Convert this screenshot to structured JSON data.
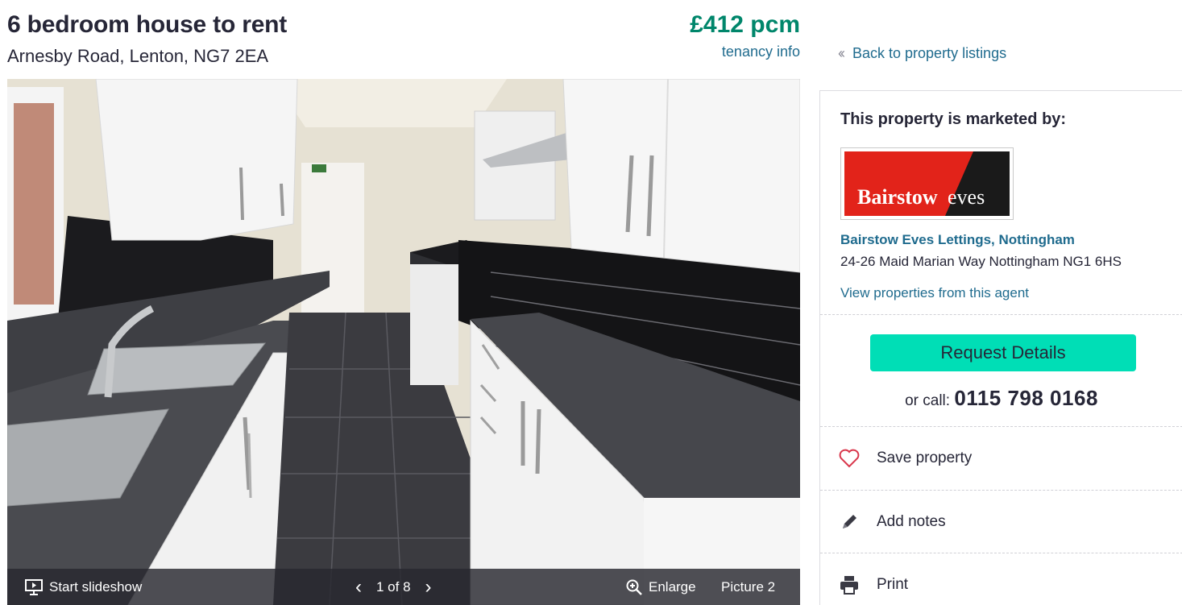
{
  "listing": {
    "title": "6 bedroom house to rent",
    "address": "Arnesby Road, Lenton, NG7 2EA",
    "price": "£412 pcm",
    "tenancy_link": "tenancy info"
  },
  "gallery": {
    "slideshow_label": "Start slideshow",
    "counter": "1 of 8",
    "enlarge_label": "Enlarge",
    "picture_label": "Picture 2"
  },
  "sidebar": {
    "back_link": "Back to property listings",
    "marketed_by": "This property is marketed by:",
    "agent_logo_text": "Bairstow eves",
    "agent_name": "Bairstow Eves Lettings, Nottingham",
    "agent_address": "24-26 Maid Marian Way Nottingham NG1 6HS",
    "view_properties": "View properties from this agent",
    "request_button": "Request Details",
    "call_prefix": "or call:",
    "phone": "0115 798 0168",
    "actions": [
      {
        "label": "Save property",
        "icon": "heart-icon"
      },
      {
        "label": "Add notes",
        "icon": "pencil-icon"
      },
      {
        "label": "Print",
        "icon": "printer-icon"
      }
    ]
  },
  "colors": {
    "price_green": "#00866b",
    "link_blue": "#1f6b8e",
    "cta_teal": "#00deb6",
    "logo_red": "#e2231a",
    "heart_red": "#d9364b"
  }
}
